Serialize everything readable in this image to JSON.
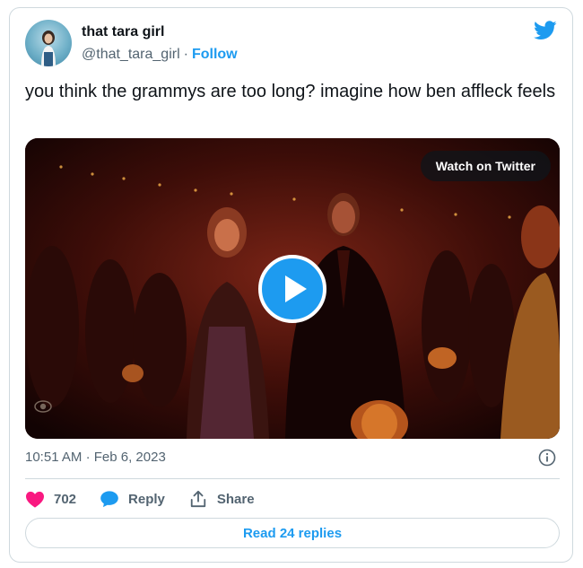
{
  "author": {
    "display_name": "that tara girl",
    "handle": "@that_tara_girl",
    "separator": "·",
    "follow_label": "Follow"
  },
  "tweet": {
    "text": "you think the grammys are too long? imagine how ben affleck feels",
    "time": "10:51 AM",
    "separator": "·",
    "date": "Feb 6, 2023"
  },
  "media": {
    "watch_label": "Watch on Twitter",
    "play_icon": "play-icon",
    "network_logo": "cbs-eye-logo"
  },
  "engagement": {
    "like_count": "702",
    "reply_label": "Reply",
    "share_label": "Share",
    "read_replies_label": "Read 24 replies"
  },
  "colors": {
    "accent": "#1d9bf0",
    "like": "#f91880",
    "text": "#0f1419",
    "secondary": "#536471",
    "border": "#cfd9de"
  },
  "icons": [
    "twitter-bird-icon",
    "heart-icon",
    "reply-bubble-icon",
    "share-icon",
    "info-icon"
  ]
}
